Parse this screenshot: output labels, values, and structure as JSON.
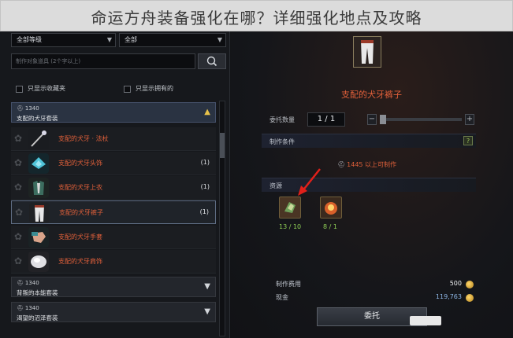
{
  "banner": {
    "title": "命运方舟装备强化在哪？详细强化地点及攻略"
  },
  "filters": {
    "grade_select": "全部等级",
    "type_select": "全部",
    "search_placeholder": "制作对象道具 (2个字以上)",
    "only_favorites": "只显示收藏夹",
    "only_owned": "只显示拥有的"
  },
  "groups": [
    {
      "level": "1340",
      "name": "支配的犬牙套装",
      "state": "open"
    },
    {
      "level": "1340",
      "name": "背叛的本能套装",
      "state": "closed"
    },
    {
      "level": "1340",
      "name": "渴望的沼泽套装",
      "state": "closed"
    }
  ],
  "items": [
    {
      "name": "支配的犬牙 · 法杖",
      "count": "",
      "icon": "staff-icon"
    },
    {
      "name": "支配的犬牙头饰",
      "count": "(1)",
      "icon": "headpiece-icon"
    },
    {
      "name": "支配的犬牙上衣",
      "count": "(1)",
      "icon": "chest-icon"
    },
    {
      "name": "支配的犬牙裤子",
      "count": "(1)",
      "icon": "pants-icon"
    },
    {
      "name": "支配的犬牙手套",
      "count": "",
      "icon": "gloves-icon"
    },
    {
      "name": "支配的犬牙肩饰",
      "count": "",
      "icon": "shoulder-icon"
    }
  ],
  "detail": {
    "title": "支配的犬牙裤子",
    "commission_qty_label": "委托数量",
    "commission_qty": "1 / 1",
    "condition_header": "制作条件",
    "condition_text": "1445 以上可制作",
    "materials_header": "资源",
    "materials": [
      {
        "icon": "material-icon",
        "count": "13 / 10"
      },
      {
        "icon": "fire-orb-icon",
        "count": "8 / 1"
      }
    ],
    "cost_label": "制作费用",
    "cost_value": "500",
    "cash_label": "现金",
    "cash_value": "119,763",
    "commission_button": "委托"
  },
  "colors": {
    "accent_orange": "#e2603a",
    "ok_green": "#8fcf55",
    "gold": "#e8c24a"
  }
}
